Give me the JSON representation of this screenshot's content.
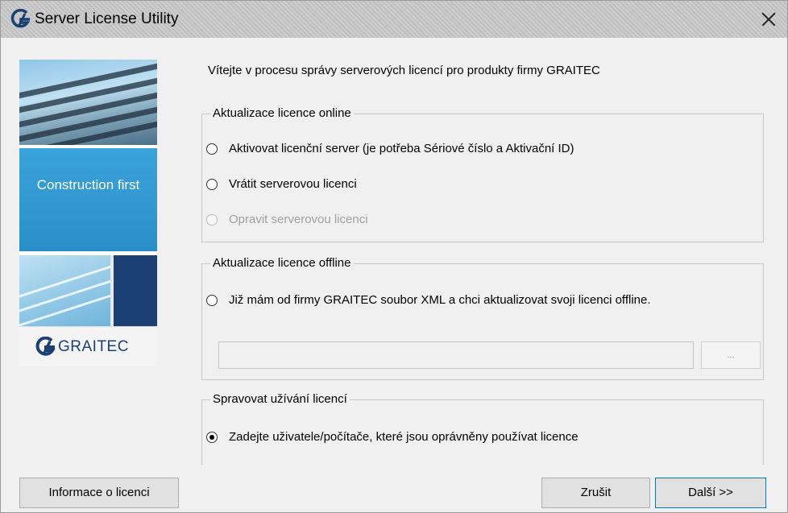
{
  "window": {
    "title": "Server License Utility"
  },
  "banner": {
    "caption": "Construction first",
    "brand": "GRAITEC"
  },
  "welcome_text": "Vítejte v procesu správy serverových licencí pro produkty firmy GRAITEC",
  "online_group": {
    "legend": "Aktualizace licence online",
    "options": [
      {
        "label": "Aktivovat licenční server (je potřeba Sériové číslo a Aktivační ID)",
        "selected": false,
        "enabled": true
      },
      {
        "label": "Vrátit serverovou licenci",
        "selected": false,
        "enabled": true
      },
      {
        "label": "Opravit serverovou licenci",
        "selected": false,
        "enabled": false
      }
    ]
  },
  "offline_group": {
    "legend": "Aktualizace licence offline",
    "option": {
      "label": "Již mám od firmy GRAITEC soubor XML a chci aktualizovat svoji licenci offline.",
      "selected": false,
      "enabled": true
    },
    "file_path": "",
    "browse_label": "..."
  },
  "manage_group": {
    "legend": "Spravovat užívání licencí",
    "option": {
      "label": "Zadejte uživatele/počítače, které jsou oprávněny používat licence",
      "selected": true,
      "enabled": true
    }
  },
  "buttons": {
    "info": "Informace o licenci",
    "cancel": "Zrušit",
    "next": "Další >>"
  },
  "colors": {
    "brand_blue": "#1c3f74",
    "banner_blue": "#3aa3da",
    "focus_border": "#0078d7"
  }
}
